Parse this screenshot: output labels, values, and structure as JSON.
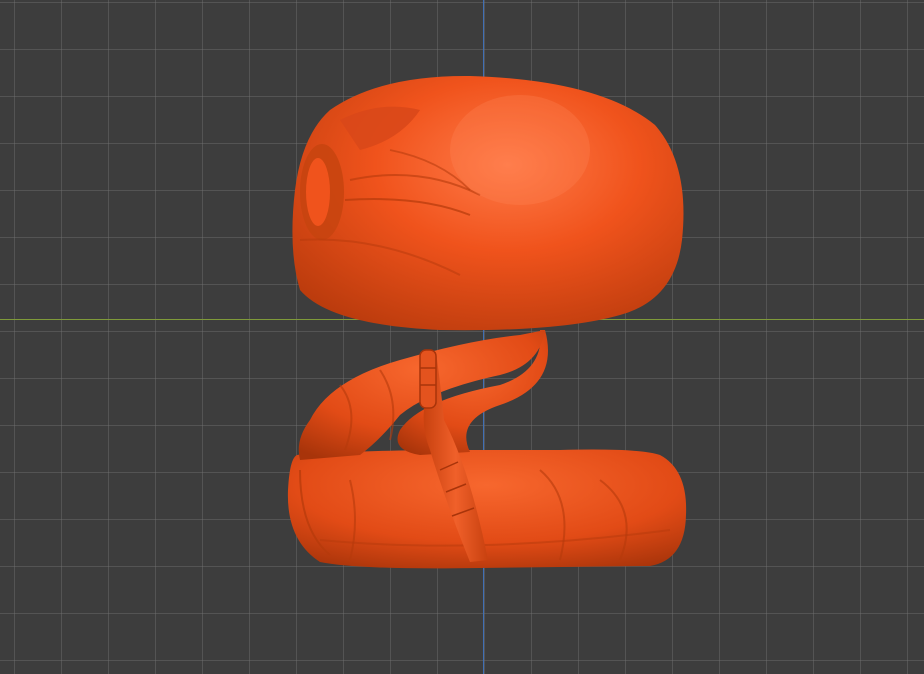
{
  "viewport": {
    "background": "#3d3d3d",
    "grid_color": "#5a5a5a"
  },
  "axes": {
    "x_axis_color": "#7f9a3a",
    "y_axis_color": "#3f6fb5"
  },
  "model": {
    "name_icon": "snake-sculpt-icon",
    "material_color": "#f0531c",
    "highlight_color": "#ff8a5a",
    "shadow_color": "#b83a0c"
  }
}
